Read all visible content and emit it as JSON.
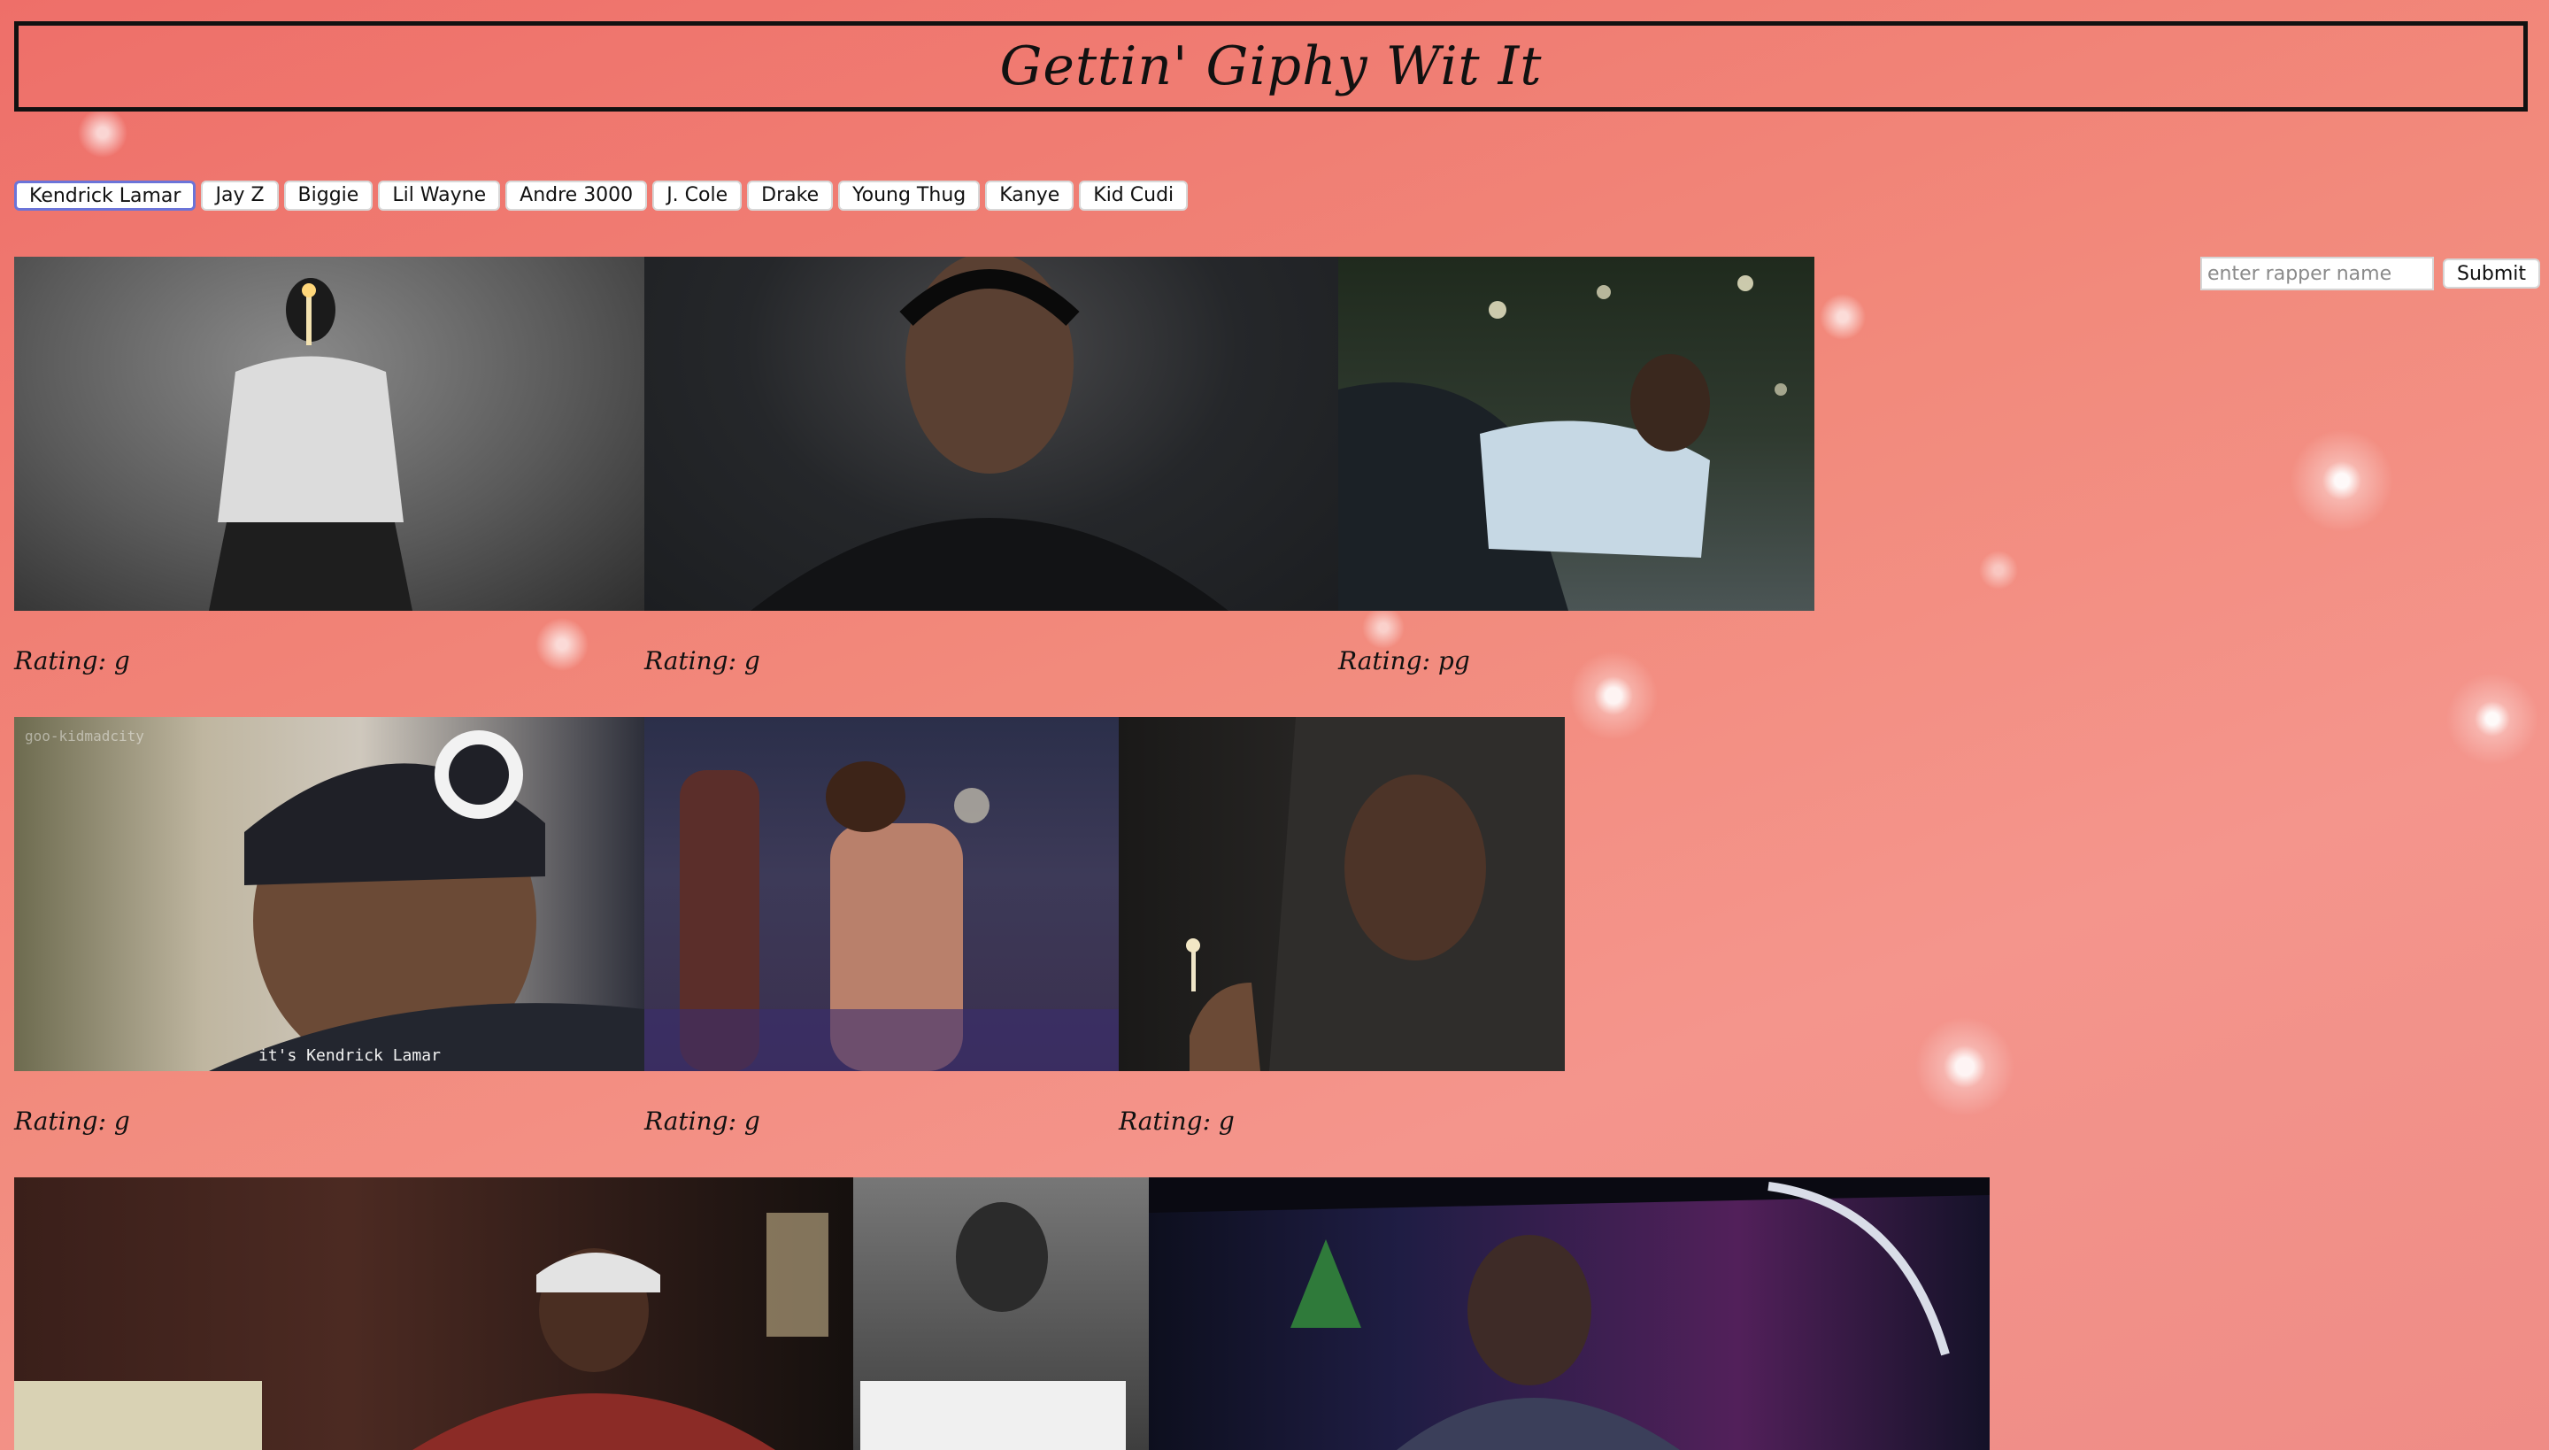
{
  "header": {
    "title": "Gettin' Giphy Wit It"
  },
  "rappers": [
    "Kendrick Lamar",
    "Jay Z",
    "Biggie",
    "Lil Wayne",
    "Andre 3000",
    "J. Cole",
    "Drake",
    "Young Thug",
    "Kanye",
    "Kid Cudi"
  ],
  "search": {
    "placeholder": "enter rapper name",
    "submit_label": "Submit"
  },
  "gifs": [
    {
      "rating": "Rating: g",
      "caption": ""
    },
    {
      "rating": "Rating: g",
      "caption": ""
    },
    {
      "rating": "Rating: pg",
      "caption": ""
    },
    {
      "rating": "Rating: g",
      "caption": "it's Kendrick Lamar",
      "watermark": "goo-kidmadcity"
    },
    {
      "rating": "Rating: g",
      "caption": ""
    },
    {
      "rating": "Rating: g",
      "caption": ""
    },
    {
      "rating": "",
      "caption": ""
    },
    {
      "rating": "",
      "caption": ""
    },
    {
      "rating": "",
      "caption": ""
    }
  ],
  "colors": {
    "background": "#f08478",
    "button_active_border": "#6b74d8",
    "text": "#111111"
  }
}
